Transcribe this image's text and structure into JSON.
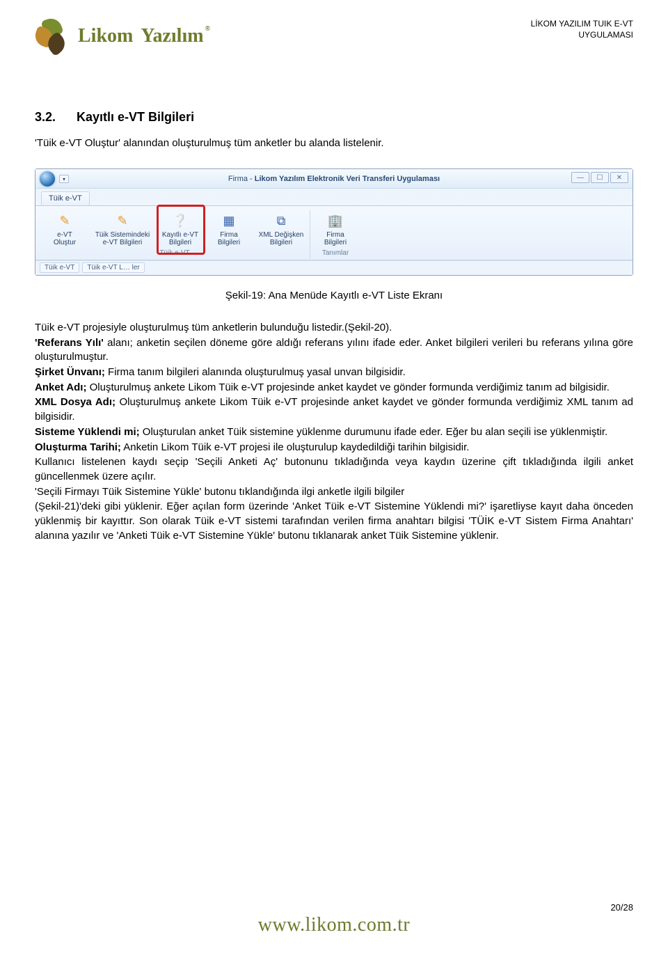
{
  "header": {
    "brand_main": "Likom",
    "brand_sub": "Yazılım",
    "brand_reg": "®",
    "right_line1": "LİKOM YAZILIM TUIK E-VT",
    "right_line2": "UYGULAMASI"
  },
  "section": {
    "num": "3.2.",
    "title": "Kayıtlı e-VT Bilgileri",
    "intro": "'Tüik e-VT Oluştur' alanından oluşturulmuş tüm anketler bu alanda listelenir."
  },
  "app": {
    "title_prefix": "Firma - ",
    "title_bold": "Likom Yazılım Elektronik Veri Transferi Uygulaması",
    "tab": "Tüik e-VT",
    "groups": {
      "g1": {
        "label": "Tüik e-VT",
        "btns": [
          {
            "label": "e-VT Oluştur",
            "icon": "pencil"
          },
          {
            "label": "Tüik Sistemindeki e-VT Bilgileri",
            "icon": "pencil"
          },
          {
            "label": "Kayıtlı e-VT Bilgileri",
            "icon": "pageq"
          },
          {
            "label": "Firma Bilgileri",
            "icon": "grid"
          },
          {
            "label": "XML Değişken Bilgileri",
            "icon": "code"
          }
        ]
      },
      "g2": {
        "label": "Tanımlar",
        "btns": [
          {
            "label": "Firma Bilgileri",
            "icon": "bldg"
          }
        ]
      }
    },
    "status_left": "Tüik e-VT",
    "status_mid": "Tüik e-VT L… ler"
  },
  "figure_caption": "Şekil-19: Ana Menüde Kayıtlı e-VT Liste Ekranı",
  "body": {
    "p1a": "Tüik e-VT projesiyle oluşturulmuş tüm anketlerin bulunduğu listedir.(Şekil-20).",
    "p2a": "'Referans Yılı'",
    "p2b": " alanı; anketin seçilen döneme göre aldığı referans yılını ifade eder. Anket bilgileri verileri bu referans yılına göre oluşturulmuştur.",
    "p3a": "Şirket Ünvanı;",
    "p3b": " Firma tanım bilgileri alanında oluşturulmuş yasal unvan bilgisidir.",
    "p4a": "Anket Adı;",
    "p4b": " Oluşturulmuş ankete Likom Tüik e-VT projesinde anket kaydet ve gönder formunda verdiğimiz tanım ad bilgisidir.",
    "p5a": "XML Dosya Adı;",
    "p5b": " Oluşturulmuş ankete Likom Tüik e-VT projesinde anket kaydet ve gönder formunda verdiğimiz XML tanım ad bilgisidir.",
    "p6a": "Sisteme Yüklendi mi;",
    "p6b": " Oluşturulan anket Tüik sistemine yüklenme durumunu ifade eder. Eğer bu alan seçili ise yüklenmiştir.",
    "p7a": "Oluşturma Tarihi;",
    "p7b": " Anketin Likom Tüik e-VT projesi ile oluşturulup kaydedildiği tarihin bilgisidir.",
    "p8": "Kullanıcı listelenen kaydı seçip 'Seçili Anketi Aç' butonunu tıkladığında veya kaydın üzerine çift tıkladığında ilgili anket güncellenmek üzere açılır.",
    "p9": "'Seçili Firmayı Tüik Sistemine Yükle' butonu tıklandığında ilgi anketle ilgili bilgiler",
    "p10": "(Şekil-21)'deki gibi yüklenir. Eğer açılan form üzerinde 'Anket Tüik e-VT Sistemine Yüklendi mi?' işaretliyse kayıt daha önceden yüklenmiş bir kayıttır. Son olarak Tüik e-VT sistemi tarafından verilen firma anahtarı bilgisi 'TÜİK e-VT Sistem Firma Anahtarı' alanına yazılır ve 'Anketi Tüik e-VT Sistemine Yükle' butonu tıklanarak anket Tüik Sistemine yüklenir."
  },
  "footer": {
    "url": "www.likom.com.tr",
    "page": "20/28"
  }
}
